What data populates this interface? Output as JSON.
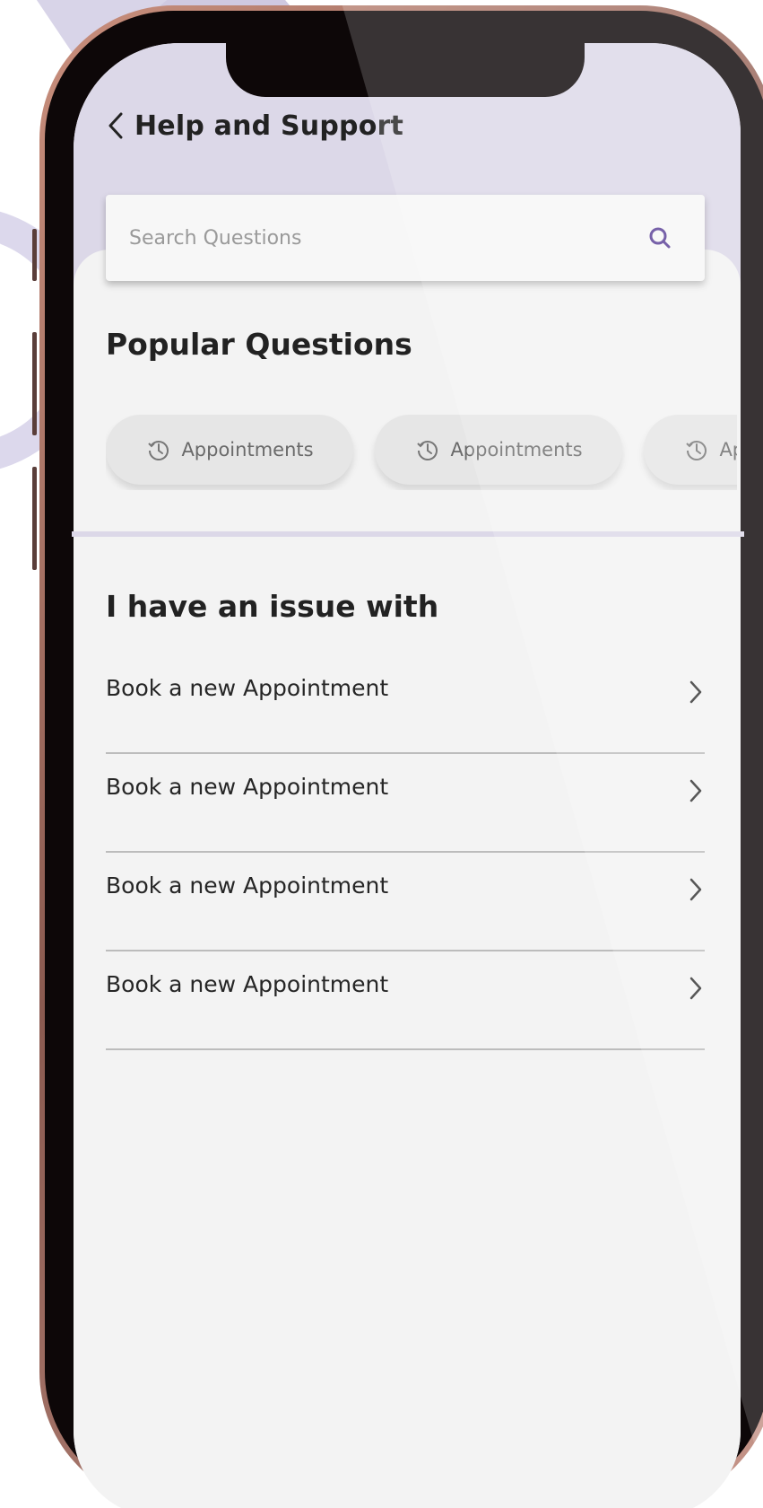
{
  "header": {
    "title": "Help and Support",
    "back_icon": "chevron-left-icon"
  },
  "search": {
    "placeholder": "Search Questions",
    "value": "",
    "icon": "search-icon"
  },
  "popular": {
    "title": "Popular Questions",
    "chips": [
      {
        "label": "Appointments",
        "icon": "history-icon"
      },
      {
        "label": "Appointments",
        "icon": "history-icon"
      },
      {
        "label": "Appointments",
        "icon": "history-icon"
      }
    ]
  },
  "issues": {
    "title": "I have an issue with",
    "items": [
      {
        "label": "Book a new Appointment",
        "icon": "chevron-right-icon"
      },
      {
        "label": "Book a new Appointment",
        "icon": "chevron-right-icon"
      },
      {
        "label": "Book a new Appointment",
        "icon": "chevron-right-icon"
      },
      {
        "label": "Book a new Appointment",
        "icon": "chevron-right-icon"
      }
    ]
  },
  "colors": {
    "accent": "#5a3f96",
    "header_bg": "#dcd8e8",
    "screen_bg": "#f2f2f2",
    "frame": "#0d0708"
  }
}
